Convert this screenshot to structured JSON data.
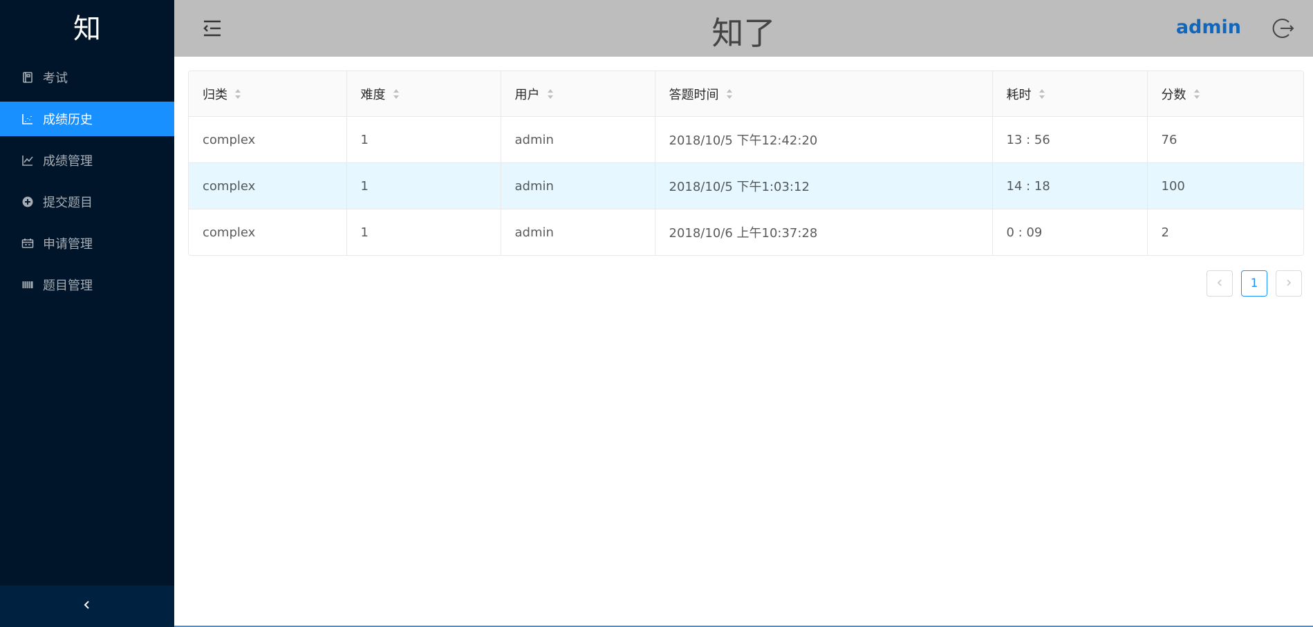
{
  "sidebar": {
    "logo": "知",
    "items": [
      {
        "label": "考试",
        "icon": "book-icon",
        "active": false
      },
      {
        "label": "成绩历史",
        "icon": "dot-chart-icon",
        "active": true
      },
      {
        "label": "成绩管理",
        "icon": "line-chart-icon",
        "active": false
      },
      {
        "label": "提交题目",
        "icon": "plus-circle-icon",
        "active": false
      },
      {
        "label": "申请管理",
        "icon": "schedule-icon",
        "active": false
      },
      {
        "label": "题目管理",
        "icon": "barcode-icon",
        "active": false
      }
    ],
    "collapse_icon": "chevron-left-icon"
  },
  "header": {
    "title": "知了",
    "user": "admin",
    "menu_fold_icon": "menu-fold-icon",
    "logout_icon": "logout-icon"
  },
  "table": {
    "columns": [
      "归类",
      "难度",
      "用户",
      "答题时间",
      "耗时",
      "分数"
    ],
    "rows": [
      [
        "complex",
        "1",
        "admin",
        "2018/10/5 下午12:42:20",
        "13 : 56",
        "76"
      ],
      [
        "complex",
        "1",
        "admin",
        "2018/10/5 下午1:03:12",
        "14 : 18",
        "100"
      ],
      [
        "complex",
        "1",
        "admin",
        "2018/10/6 上午10:37:28",
        "0 : 09",
        "2"
      ]
    ],
    "hovered_row": 1
  },
  "pagination": {
    "current": "1",
    "prev_icon": "chevron-left-icon",
    "next_icon": "chevron-right-icon"
  },
  "colors": {
    "sidebar_bg": "#001529",
    "sidebar_active": "#1890ff",
    "header_bg": "#bdbdbd",
    "user_name": "#1466b8",
    "row_hover": "#e6f7ff"
  }
}
